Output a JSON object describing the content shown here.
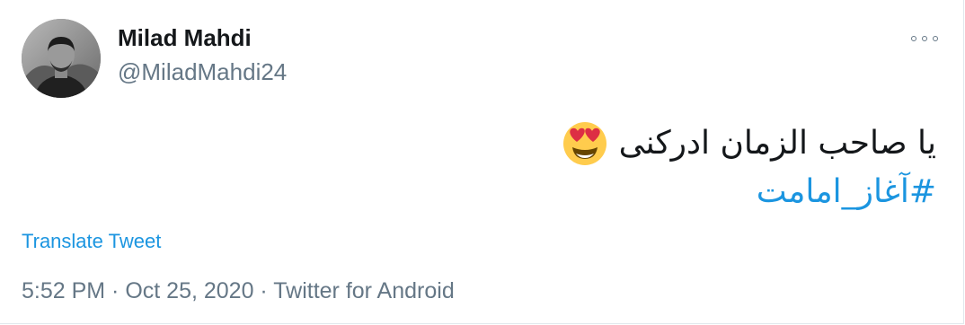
{
  "user": {
    "display_name": "Milad Mahdi",
    "handle": "@MiladMahdi24",
    "avatar_icon": "profile-photo"
  },
  "menu": {
    "more_icon": "ellipsis-icon"
  },
  "tweet": {
    "text": "یا صاحب الزمان ادرکنی",
    "emoji": "heart-eyes-emoji",
    "hashtag": "#آغاز_امامت",
    "hashtag_color": "#1b95e0"
  },
  "actions": {
    "translate_label": "Translate Tweet"
  },
  "meta": {
    "time": "5:52 PM",
    "separator_1": " · ",
    "date": "Oct 25, 2020",
    "separator_2": " · ",
    "source": "Twitter for Android"
  }
}
